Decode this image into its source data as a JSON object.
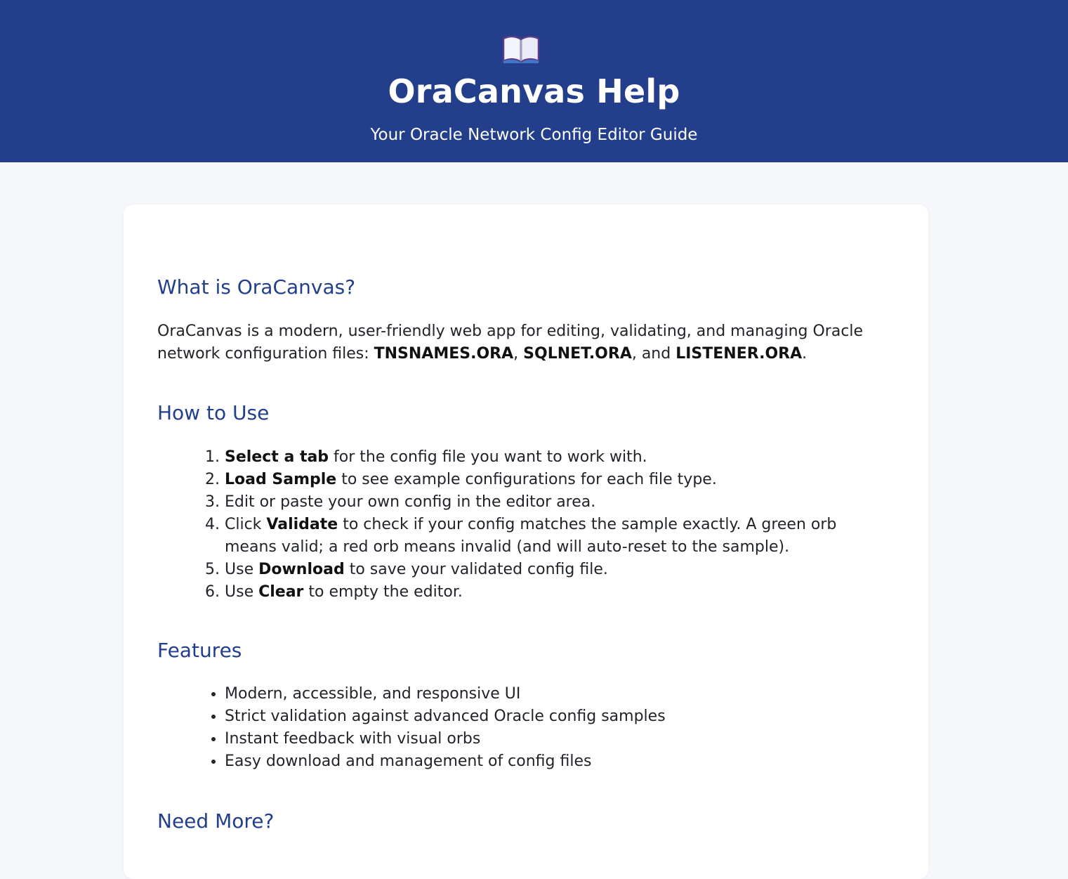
{
  "header": {
    "icon": "open-book-icon",
    "title": "OraCanvas Help",
    "subtitle": "Your Oracle Network Config Editor Guide"
  },
  "sections": [
    {
      "title": "What is OraCanvas?",
      "paragraph": {
        "text_1": "OraCanvas is a modern, user-friendly web app for editing, validating, and managing Oracle network configuration files: ",
        "file_1": "TNSNAMES.ORA",
        "sep_1": ", ",
        "file_2": "SQLNET.ORA",
        "sep_2": ", and ",
        "file_3": "LISTENER.ORA",
        "end": "."
      }
    },
    {
      "title": "How to Use",
      "steps": [
        {
          "before": "",
          "bold": "Select a tab",
          "after": " for the config file you want to work with."
        },
        {
          "before": "",
          "bold": "Load Sample",
          "after": " to see example configurations for each file type."
        },
        {
          "before": "Edit or paste your own config in the editor area.",
          "bold": "",
          "after": ""
        },
        {
          "before": "Click ",
          "bold": "Validate",
          "after": " to check if your config matches the sample exactly. A green orb means valid; a red orb means invalid (and will auto-reset to the sample)."
        },
        {
          "before": "Use ",
          "bold": "Download",
          "after": " to save your validated config file."
        },
        {
          "before": "Use ",
          "bold": "Clear",
          "after": " to empty the editor."
        }
      ]
    },
    {
      "title": "Features",
      "items": [
        "Modern, accessible, and responsive UI",
        "Strict validation against advanced Oracle config samples",
        "Instant feedback with visual orbs",
        "Easy download and management of config files"
      ]
    },
    {
      "title": "Need More?"
    }
  ],
  "colors": {
    "header_bg": "#233f8b",
    "heading": "#233f8b",
    "page_bg": "#f5f7fb",
    "card_bg": "#ffffff"
  }
}
